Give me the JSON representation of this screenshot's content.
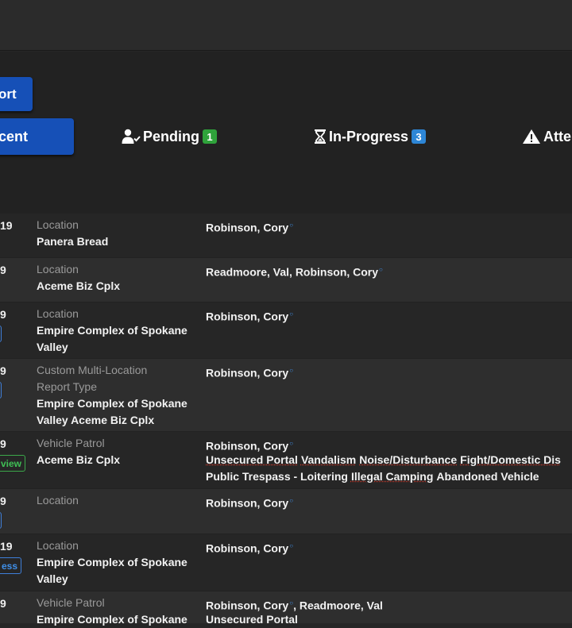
{
  "toolbar": {
    "report_label": "ort"
  },
  "tabs": [
    {
      "label": "cent",
      "active": true
    },
    {
      "label": "Pending",
      "badge": "1",
      "badge_color": "#2fa33b",
      "icon": "user-check-icon"
    },
    {
      "label": "In-Progress",
      "badge": "3",
      "badge_color": "#2d86d6",
      "icon": "hourglass-icon"
    },
    {
      "label": "Atte",
      "icon": "warning-icon"
    }
  ],
  "rows": [
    {
      "date": "19",
      "loc_type": "Location",
      "loc_name": "Panera Bread",
      "people": "Robinson, Cory"
    },
    {
      "date": "9",
      "loc_type": "Location",
      "loc_name": "Aceme Biz Cplx",
      "people": "Readmoore, Val, Robinson, Cory"
    },
    {
      "date": "9",
      "status": "",
      "loc_type": "Location",
      "loc_name": "Empire Complex of Spokane Valley",
      "people": "Robinson, Cory"
    },
    {
      "date": "9",
      "status": "",
      "loc_type": "Custom Multi-Location Report Type",
      "loc_name": "Empire Complex of Spokane Valley Aceme Biz Cplx",
      "people": "Robinson, Cory"
    },
    {
      "date": "9",
      "status": "view",
      "loc_type": "Vehicle Patrol",
      "loc_name": "Aceme Biz Cplx",
      "people": "Robinson, Cory",
      "tags": [
        "Unsecured Portal",
        "Vandalism",
        "Noise/Disturbance",
        "Fight/Domestic Dis",
        "Public Trespass - Loitering",
        "Illegal Camping",
        "Abandoned Vehicle"
      ]
    },
    {
      "date": "9",
      "status": "",
      "loc_type": "Location",
      "loc_name": "",
      "people": "Robinson, Cory"
    },
    {
      "date": "19",
      "status": "ess",
      "loc_type": "Location",
      "loc_name": "Empire Complex of Spokane Valley",
      "people": "Robinson, Cory"
    },
    {
      "date": "9",
      "loc_type": "Vehicle Patrol",
      "loc_name": "Empire Complex of Spokane",
      "people_a": "Robinson, Cory",
      "people_b": ", Readmoore, Val",
      "tags": [
        "Unsecured Portal"
      ]
    }
  ]
}
